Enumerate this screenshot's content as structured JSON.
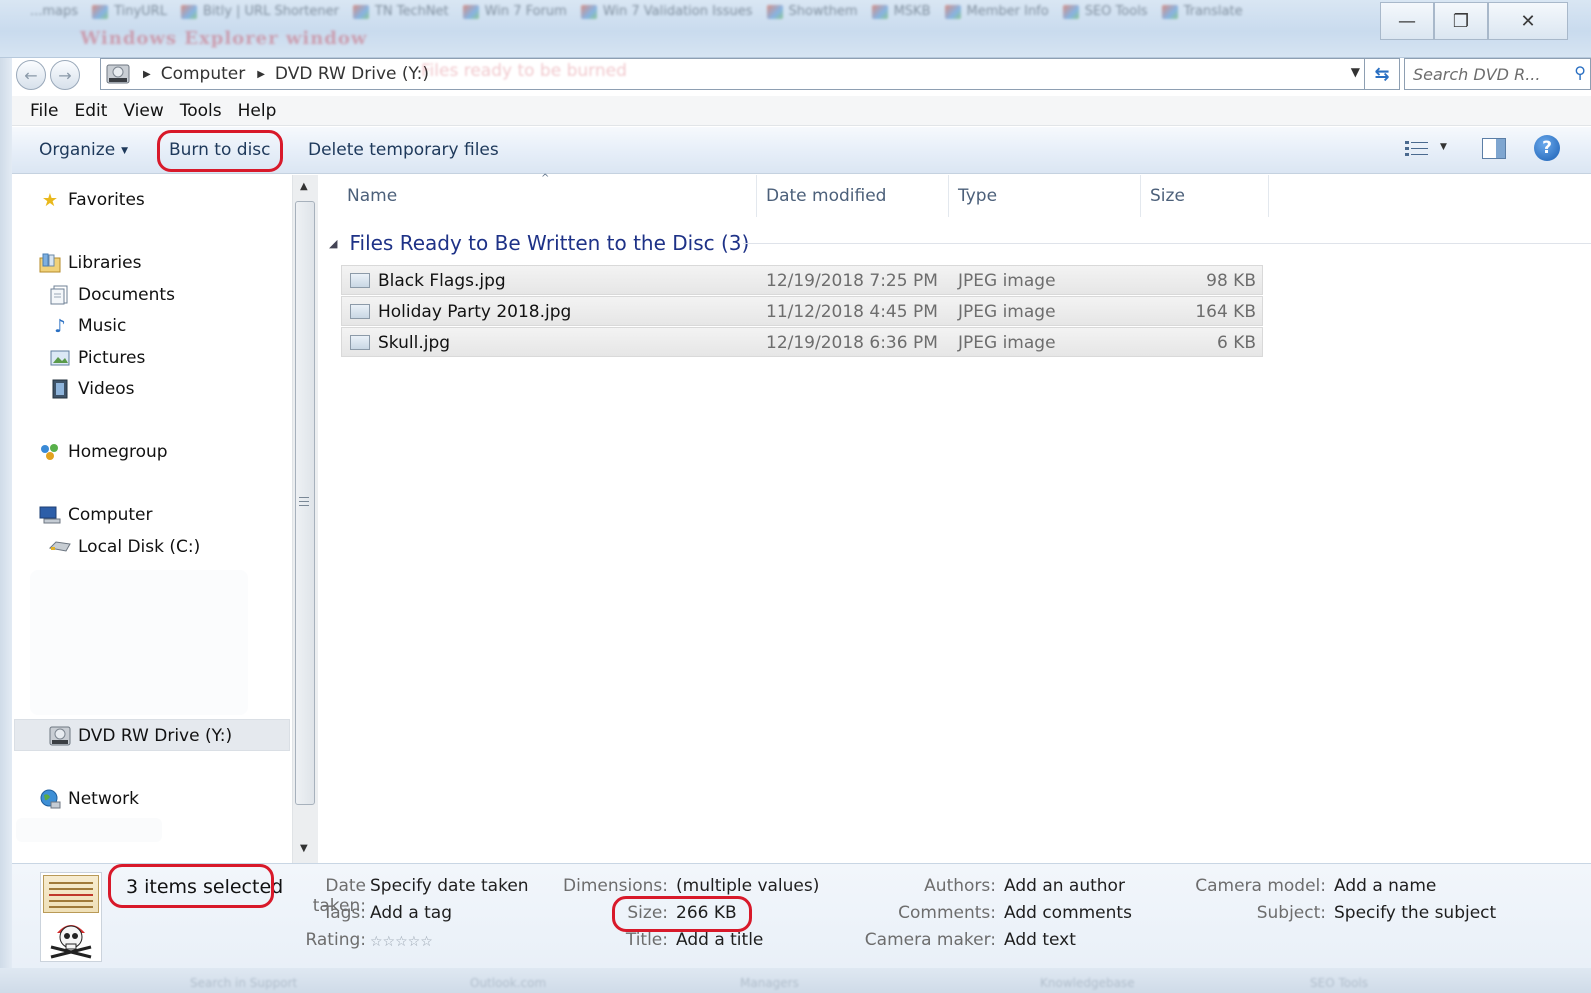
{
  "window": {
    "title": "Windows Explorer window",
    "background_items": [
      "...maps",
      "TinyURL",
      "Bitly | URL Shortener",
      "TN TechNet",
      "Win 7 Forum",
      "Win 7 Validation Issues",
      "Showthem",
      "MSKB",
      "Member Info",
      "SEO Tools",
      "Translate"
    ],
    "address_ghost_text": "Files ready to be burned",
    "minimize_glyph": "—",
    "maximize_glyph": "❐",
    "close_glyph": "✕"
  },
  "address": {
    "crumbs": [
      "Computer",
      "DVD RW Drive (Y:)"
    ],
    "back_glyph": "←",
    "forward_glyph": "→",
    "refresh_glyph": "⇆",
    "search_placeholder": "Search DVD R...",
    "search_icon": "search-icon"
  },
  "menu": [
    "File",
    "Edit",
    "View",
    "Tools",
    "Help"
  ],
  "toolbar": {
    "organize": "Organize",
    "burn": "Burn to disc",
    "delete_temp": "Delete temporary files",
    "help_glyph": "?",
    "accent": "#d8192a"
  },
  "nav": {
    "favorites": "Favorites",
    "libraries": "Libraries",
    "documents": "Documents",
    "music": "Music",
    "pictures": "Pictures",
    "videos": "Videos",
    "homegroup": "Homegroup",
    "computer": "Computer",
    "local_disk": "Local Disk (C:)",
    "dvd_drive": "DVD RW Drive (Y:)",
    "network": "Network"
  },
  "columns": {
    "name": "Name",
    "date": "Date modified",
    "type": "Type",
    "size": "Size"
  },
  "group": {
    "label": "Files Ready to Be Written to the Disc (3)"
  },
  "files": [
    {
      "name": "Black Flags.jpg",
      "date": "12/19/2018 7:25 PM",
      "type": "JPEG image",
      "size": "98 KB"
    },
    {
      "name": "Holiday Party 2018.jpg",
      "date": "11/12/2018 4:45 PM",
      "type": "JPEG image",
      "size": "164 KB"
    },
    {
      "name": "Skull.jpg",
      "date": "12/19/2018 6:36 PM",
      "type": "JPEG image",
      "size": "6 KB"
    }
  ],
  "details": {
    "selected": "3 items selected",
    "date_taken_label": "Date taken:",
    "date_taken_value": "Specify date taken",
    "tags_label": "Tags:",
    "tags_value": "Add a tag",
    "rating_label": "Rating:",
    "rating_stars": "☆☆☆☆☆",
    "dimensions_label": "Dimensions:",
    "dimensions_value": "(multiple values)",
    "size_label": "Size:",
    "size_value": "266 KB",
    "title_label": "Title:",
    "title_value": "Add a title",
    "authors_label": "Authors:",
    "authors_value": "Add an author",
    "comments_label": "Comments:",
    "comments_value": "Add comments",
    "camera_maker_label": "Camera maker:",
    "camera_maker_value": "Add text",
    "camera_model_label": "Camera model:",
    "camera_model_value": "Add a name",
    "subject_label": "Subject:",
    "subject_value": "Specify the subject"
  },
  "bottom_ghost": [
    "Search in Support",
    "Outlook.com",
    "Managers",
    "Knowledgebase",
    "SEO Tools"
  ]
}
